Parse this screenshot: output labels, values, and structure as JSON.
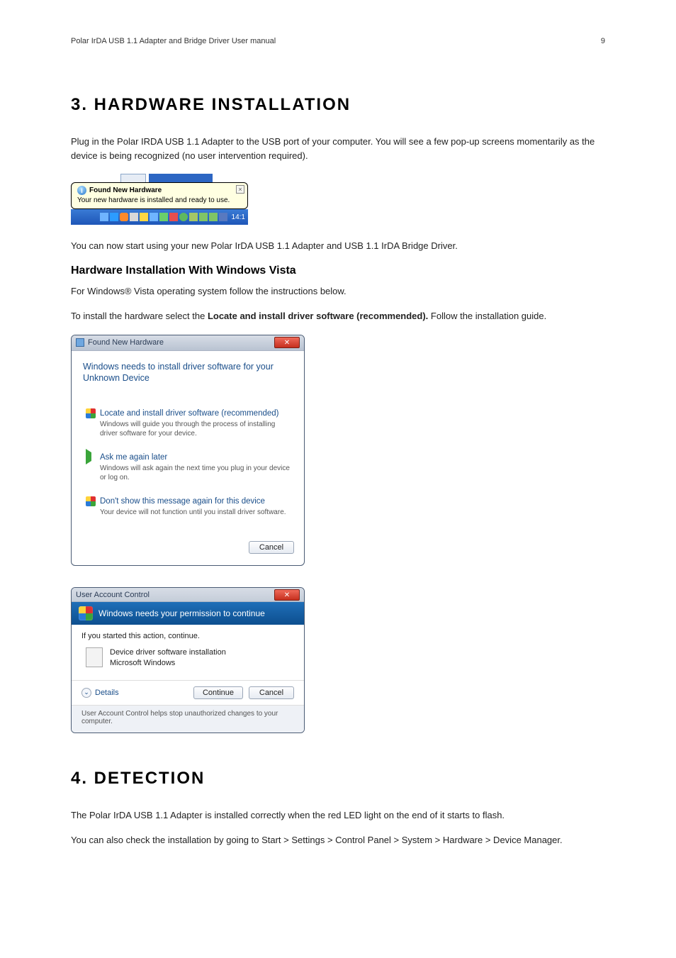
{
  "header": {
    "doc_title": "Polar IrDA USB 1.1 Adapter and Bridge Driver User manual",
    "page_number": "9"
  },
  "section3": {
    "heading": "3. HARDWARE INSTALLATION",
    "p1": "Plug in the Polar IRDA USB 1.1 Adapter to the USB port of your computer. You will see a few pop-up screens momentarily as the device is being recognized (no user intervention required).",
    "p2": "You can now start using your new Polar IrDA USB 1.1 Adapter and USB 1.1 IrDA Bridge Driver.",
    "sub_heading": "Hardware Installation With Windows Vista",
    "p3": "For Windows® Vista operating system follow the instructions below.",
    "p4_pre": "To install the hardware select the ",
    "p4_bold": "Locate and install driver software (recommended).",
    "p4_post": " Follow the installation guide."
  },
  "xp_balloon": {
    "info_glyph": "i",
    "title": "Found New Hardware",
    "close_glyph": "×",
    "text": "Your new hardware is installed and ready to use.",
    "clock": "14:1"
  },
  "vista_fnh": {
    "window_title": "Found New Hardware",
    "close_glyph": "✕",
    "heading": "Windows needs to install driver software for your Unknown Device",
    "opt1_title": "Locate and install driver software (recommended)",
    "opt1_sub": "Windows will guide you through the process of installing driver software for your device.",
    "opt2_title": "Ask me again later",
    "opt2_sub": "Windows will ask again the next time you plug in your device or log on.",
    "opt3_title": "Don't show this message again for this device",
    "opt3_sub": "Your device will not function until you install driver software.",
    "cancel": "Cancel"
  },
  "uac": {
    "window_title": "User Account Control",
    "close_glyph": "✕",
    "banner": "Windows needs your permission to continue",
    "line1": "If you started this action, continue.",
    "prog_name": "Device driver software installation",
    "prog_pub": "Microsoft Windows",
    "details": "Details",
    "chevron": "⌄",
    "continue": "Continue",
    "cancel": "Cancel",
    "foot": "User Account Control helps stop unauthorized changes to your computer."
  },
  "section4": {
    "heading": "4. DETECTION",
    "p1": "The Polar IrDA USB 1.1 Adapter is installed correctly when the red LED light on the end of it starts to flash.",
    "p2": "You can also check the installation by going to Start > Settings > Control Panel > System > Hardware > Device Manager."
  }
}
